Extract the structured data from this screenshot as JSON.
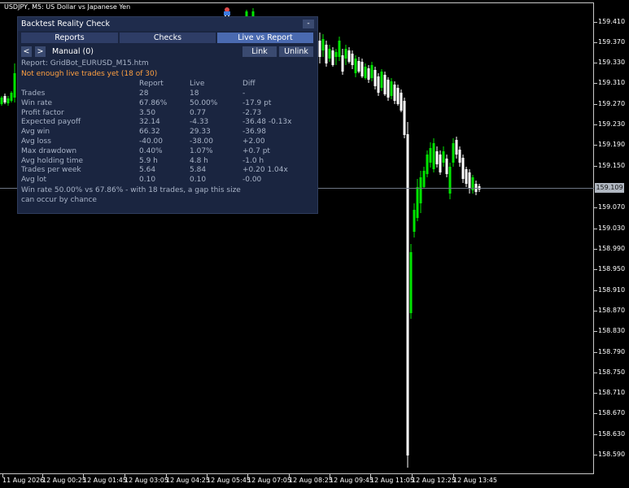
{
  "chart": {
    "title": "USDJPY, M5:  US Dollar vs Japanese Yen",
    "current_price": "159.109",
    "colors": {
      "bull": "#00e600",
      "bear": "#ffffff",
      "background": "#000000",
      "grid_line": "#6d7684"
    },
    "y_labels": [
      "159.410",
      "159.370",
      "159.330",
      "159.310",
      "159.270",
      "159.230",
      "159.190",
      "159.150",
      "159.109",
      "159.070",
      "159.030",
      "158.990",
      "158.950",
      "158.910",
      "158.870",
      "158.830",
      "158.790",
      "158.750",
      "158.710",
      "158.670",
      "158.630",
      "158.590"
    ],
    "x_labels": [
      "11 Aug 2026",
      "12 Aug 00:25",
      "12 Aug 01:45",
      "12 Aug 03:05",
      "12 Aug 04:25",
      "12 Aug 05:45",
      "12 Aug 07:05",
      "12 Aug 08:25",
      "12 Aug 09:45",
      "12 Aug 11:05",
      "12 Aug 12:25",
      "12 Aug 13:45"
    ]
  },
  "panel": {
    "title": "Backtest Reality Check",
    "minimize": "-",
    "tabs": [
      "Reports",
      "Checks",
      "Live vs Report"
    ],
    "active_tab": "Live vs Report",
    "prev": "<",
    "next": ">",
    "manual": "Manual (0)",
    "link": "Link",
    "unlink": "Unlink",
    "report_line": "Report: GridBot_EURUSD_M15.htm",
    "warning": "Not enough live trades yet (18 of 30)",
    "warning_color": "#ffa040",
    "columns": [
      "Report",
      "Live",
      "Diff"
    ],
    "rows": [
      {
        "metric": "Trades",
        "report": "28",
        "live": "18",
        "diff": "-"
      },
      {
        "metric": "Win rate",
        "report": "67.86%",
        "live": "50.00%",
        "diff": "-17.9 pt"
      },
      {
        "metric": "Profit factor",
        "report": "3.50",
        "live": "0.77",
        "diff": "-2.73"
      },
      {
        "metric": "Expected payoff",
        "report": "32.14",
        "live": "-4.33",
        "diff": "-36.48  -0.13x"
      },
      {
        "metric": "Avg win",
        "report": "66.32",
        "live": "29.33",
        "diff": "-36.98"
      },
      {
        "metric": "Avg loss",
        "report": "-40.00",
        "live": "-38.00",
        "diff": "+2.00"
      },
      {
        "metric": "Max drawdown",
        "report": "0.40%",
        "live": "1.07%",
        "diff": "+0.7 pt"
      },
      {
        "metric": "Avg holding time",
        "report": "5.9 h",
        "live": "4.8 h",
        "diff": "-1.0 h"
      },
      {
        "metric": "Trades per week",
        "report": "5.64",
        "live": "5.84",
        "diff": "+0.20  1.04x"
      },
      {
        "metric": "Avg lot",
        "report": "0.10",
        "live": "0.10",
        "diff": "-0.00"
      }
    ],
    "conclusion_line1": "Win rate 50.00% vs 67.86% - with 18 trades, a gap this size",
    "conclusion_line2": "can occur by chance"
  }
}
